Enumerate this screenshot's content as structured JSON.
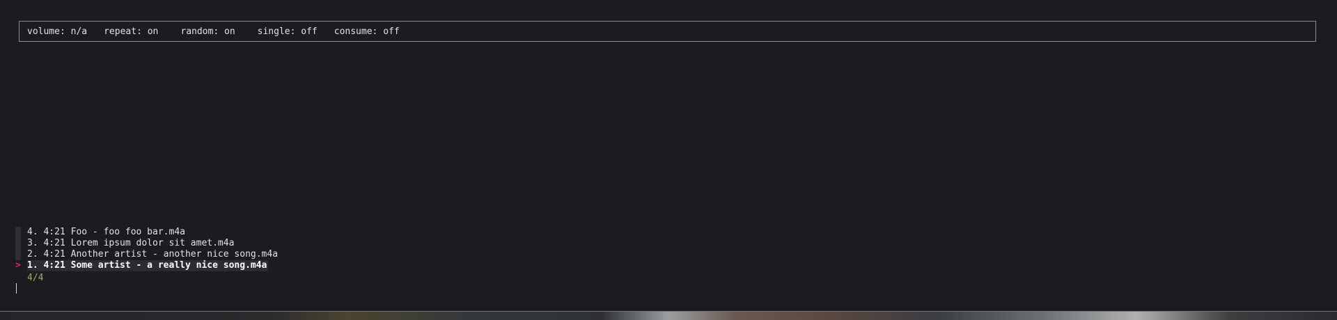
{
  "status": {
    "volume": "volume: n/a",
    "repeat": "repeat: on",
    "random": "random: on",
    "single": "single: off",
    "consume": "consume: off"
  },
  "playlist": {
    "items": [
      {
        "label": "4. 4:21 Foo - foo foo bar.m4a",
        "selected": false
      },
      {
        "label": "3. 4:21 Lorem ipsum dolor sit amet.m4a",
        "selected": false
      },
      {
        "label": "2. 4:21 Another artist - another nice song.m4a",
        "selected": false
      },
      {
        "label": "1. 4:21 Some artist - a really nice song.m4a",
        "selected": true
      }
    ],
    "cursor_symbol": ">",
    "count": "4/4"
  },
  "colors": {
    "background": "#1c1b20",
    "accent_cursor": "#e5245b",
    "count_text": "#a9a26c"
  }
}
